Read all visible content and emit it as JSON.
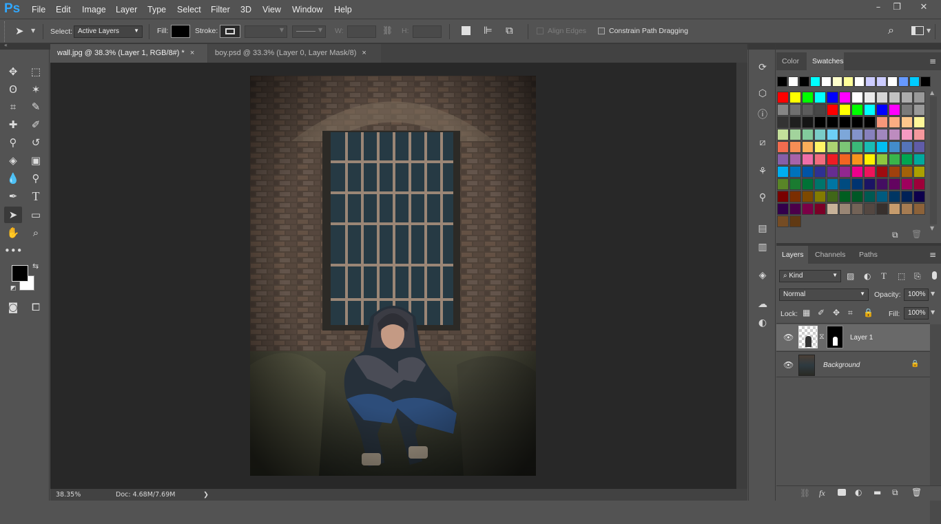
{
  "app": {
    "logo": "Ps"
  },
  "menu": [
    "File",
    "Edit",
    "Image",
    "Layer",
    "Type",
    "Select",
    "Filter",
    "3D",
    "View",
    "Window",
    "Help"
  ],
  "window_controls": [
    "–",
    "❐",
    "✕"
  ],
  "options": {
    "select_label": "Select:",
    "select_value": "Active Layers",
    "fill_label": "Fill:",
    "stroke_label": "Stroke:",
    "w_label": "W:",
    "h_label": "H:",
    "align_edges": "Align Edges",
    "constrain": "Constrain Path Dragging"
  },
  "tabs": [
    {
      "label": "wall.jpg @ 38.3% (Layer 1, RGB/8#) *",
      "close": "×"
    },
    {
      "label": "boy.psd @ 33.3% (Layer 0, Layer Mask/8)",
      "close": "×"
    }
  ],
  "status": {
    "zoom": "38.35%",
    "doc": "Doc: 4.68M/7.69M",
    "arrow": "❯"
  },
  "color_panel": {
    "tabs": [
      "Color",
      "Swatches"
    ]
  },
  "swatches": {
    "rows": [
      [
        "#000000",
        "#ffffff",
        "#000000",
        "#00ffff",
        "#ffffff",
        "#ffffcc",
        "#ffff99",
        "#ffffff",
        "#ccccff",
        "#ccccff",
        "#ffffff",
        "#6699ff",
        "#00ccff",
        "#000000"
      ],
      [
        "#ff0000",
        "#ffff00",
        "#00ff00",
        "#00ffff",
        "#0000ff",
        "#ff00ff",
        "#ffffff",
        "#ebebeb",
        "#d6d6d6",
        "#c2c2c2",
        "#adadad",
        "#999999"
      ],
      [
        "#858585",
        "#707070",
        "#5c5c5c",
        "#474747",
        "#ff0000",
        "#ffff00",
        "#00ff00",
        "#00ffff",
        "#0000ff",
        "#ff00ff",
        "#7a7a7a",
        "#999999"
      ],
      [
        "#333333",
        "#1f1f1f",
        "#141414",
        "#000000",
        "#000000",
        "#000000",
        "#000000",
        "#000000",
        "#f7977a",
        "#fbad82",
        "#fdc68c",
        "#fff799"
      ],
      [
        "#c4df9b",
        "#a2d39c",
        "#82ca9c",
        "#7accc8",
        "#6dcff6",
        "#7da7d9",
        "#8393ca",
        "#8781bd",
        "#a187be",
        "#bd8cbf",
        "#f49ac1",
        "#f5989d"
      ],
      [
        "#f26c4f",
        "#f68e55",
        "#fbaf5a",
        "#fff467",
        "#acd372",
        "#7cc576",
        "#3bb878",
        "#1abbb4",
        "#00bff3",
        "#438ccb",
        "#5574b9",
        "#605ca8"
      ],
      [
        "#855fa8",
        "#a763a9",
        "#ef6ea8",
        "#f16d7e",
        "#ed1c24",
        "#f26522",
        "#f7941d",
        "#fff200",
        "#8dc73f",
        "#39b54a",
        "#00a651",
        "#00a99d"
      ],
      [
        "#00aeef",
        "#0072bc",
        "#0054a5",
        "#2e3192",
        "#662d91",
        "#92278f",
        "#ec008c",
        "#ed145b",
        "#9e0b0f",
        "#a0410d",
        "#a36209",
        "#aba000"
      ],
      [
        "#598527",
        "#1a7b30",
        "#007236",
        "#00746b",
        "#0076a3",
        "#004b80",
        "#003471",
        "#1b1464",
        "#440e62",
        "#630460",
        "#9e005d",
        "#9e0039"
      ],
      [
        "#790000",
        "#7b2e00",
        "#7d4900",
        "#827b00",
        "#406618",
        "#005e20",
        "#005826",
        "#005952",
        "#005b7f",
        "#003663",
        "#002157",
        "#0d004c"
      ],
      [
        "#32004b",
        "#4b0049",
        "#7b0046",
        "#7a0026",
        "#c7b299",
        "#998675",
        "#736357",
        "#534741",
        "#37302d",
        "#c69c6d",
        "#a67c52",
        "#8c6239"
      ],
      [
        "#754c24",
        "#603913"
      ]
    ],
    "new_icon": "new-swatch-icon",
    "delete_icon": "trash-icon"
  },
  "layers_panel": {
    "tabs": [
      "Layers",
      "Channels",
      "Paths"
    ],
    "kind": "Kind",
    "blend_mode": "Normal",
    "opacity_label": "Opacity:",
    "opacity": "100%",
    "lock_label": "Lock:",
    "fill_label": "Fill:",
    "fill": "100%",
    "layers": [
      {
        "name": "Layer 1",
        "selected": true
      },
      {
        "name": "Background",
        "selected": false,
        "locked": true
      }
    ],
    "footer_icons": [
      "link-icon",
      "fx-icon",
      "mask-icon",
      "adjustment-icon",
      "folder-icon",
      "new-layer-icon",
      "trash-icon"
    ],
    "fx": "fx"
  },
  "colors": {
    "accent": "#31a8ff",
    "fg": "#000000",
    "bg": "#ffffff"
  }
}
